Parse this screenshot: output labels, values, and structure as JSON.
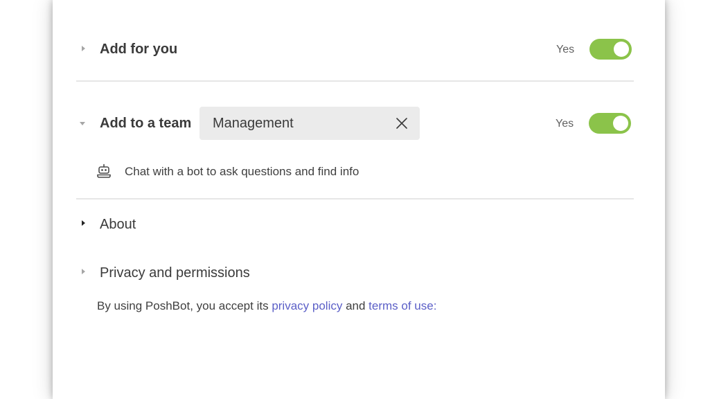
{
  "sections": {
    "add_for_you": {
      "label": "Add for you",
      "status": "Yes",
      "enabled": true
    },
    "add_to_team": {
      "label": "Add to a team",
      "selected_team": "Management",
      "status": "Yes",
      "enabled": true,
      "description": "Chat with a bot to ask questions and find info"
    },
    "about": {
      "label": "About"
    },
    "privacy": {
      "label": "Privacy and permissions",
      "text_before": "By using PoshBot, you accept its ",
      "privacy_link": "privacy policy",
      "text_middle": " and ",
      "terms_link": "terms of use",
      "text_after": ":"
    }
  },
  "colors": {
    "toggle_on": "#8bc34a",
    "link": "#5b5fc7"
  },
  "icons": {
    "toggle_chevron": "chevron-right-icon",
    "expanded_chevron": "chevron-down-icon",
    "clear": "close-icon",
    "bot": "bot-icon"
  }
}
